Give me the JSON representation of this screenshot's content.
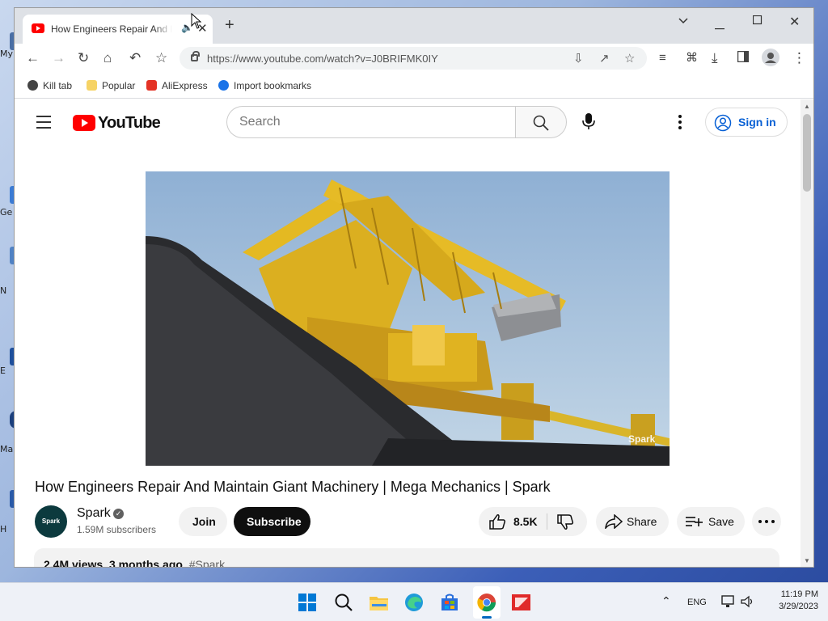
{
  "desktop": {
    "labels": [
      "My",
      "Ge",
      "N",
      "E",
      "Ma",
      "H"
    ]
  },
  "browser": {
    "tab_title": "How Engineers Repair And Maintain Giant Machinery",
    "url": "https://www.youtube.com/watch?v=J0BRIFMK0IY",
    "bookmarks": [
      {
        "label": "Kill tab",
        "icon": "globe-icon",
        "color": "#444444"
      },
      {
        "label": "Popular",
        "icon": "folder-icon",
        "color": "#f6d365"
      },
      {
        "label": "AliExpress",
        "icon": "aliexpress-icon",
        "color": "#e43225"
      },
      {
        "label": "Import bookmarks",
        "icon": "gear-icon",
        "color": "#1a73e8"
      }
    ]
  },
  "youtube": {
    "logo_text": "YouTube",
    "search_placeholder": "Search",
    "signin_label": "Sign in",
    "video": {
      "watermark": "Spark",
      "title": "How Engineers Repair And Maintain Giant Machinery | Mega Mechanics | Spark"
    },
    "channel": {
      "avatar_text": "Spark",
      "name": "Spark",
      "subscribers": "1.59M subscribers"
    },
    "actions": {
      "join": "Join",
      "subscribe": "Subscribe",
      "likes": "8.5K",
      "share": "Share",
      "save": "Save"
    },
    "description": {
      "views": "2.4M views",
      "age": "3 months ago",
      "hashtag": "#Spark"
    }
  },
  "taskbar": {
    "language": "ENG",
    "time": "11:19 PM",
    "date": "3/29/2023"
  }
}
